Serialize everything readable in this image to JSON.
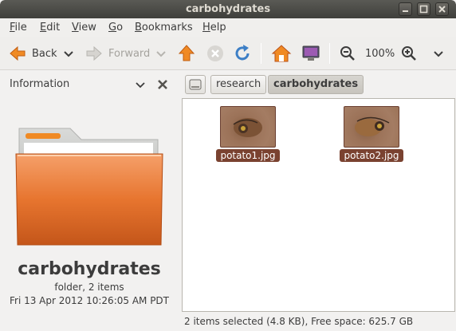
{
  "window": {
    "title": "carbohydrates"
  },
  "menubar": {
    "items": [
      {
        "label": "File",
        "mnemonic": "F",
        "rest": "ile"
      },
      {
        "label": "Edit",
        "mnemonic": "E",
        "rest": "dit"
      },
      {
        "label": "View",
        "mnemonic": "V",
        "rest": "iew"
      },
      {
        "label": "Go",
        "mnemonic": "G",
        "rest": "o"
      },
      {
        "label": "Bookmarks",
        "mnemonic": "B",
        "rest": "ookmarks"
      },
      {
        "label": "Help",
        "mnemonic": "H",
        "rest": "elp"
      }
    ]
  },
  "toolbar": {
    "back_label": "Back",
    "forward_label": "Forward",
    "zoom_level": "100%"
  },
  "sidebar": {
    "header_label": "Information",
    "folder_name": "carbohydrates",
    "folder_meta": "folder, 2 items",
    "folder_date": "Fri 13 Apr 2012 10:26:05 AM PDT"
  },
  "location": {
    "crumbs": [
      "research",
      "carbohydrates"
    ]
  },
  "files": [
    {
      "name": "potato1.jpg"
    },
    {
      "name": "potato2.jpg"
    }
  ],
  "status": {
    "text": "2 items selected (4.8 KB), Free space: 625.7 GB"
  },
  "colors": {
    "accent": "#e95420",
    "selection": "#7a4230",
    "folder": "#e7752f"
  }
}
